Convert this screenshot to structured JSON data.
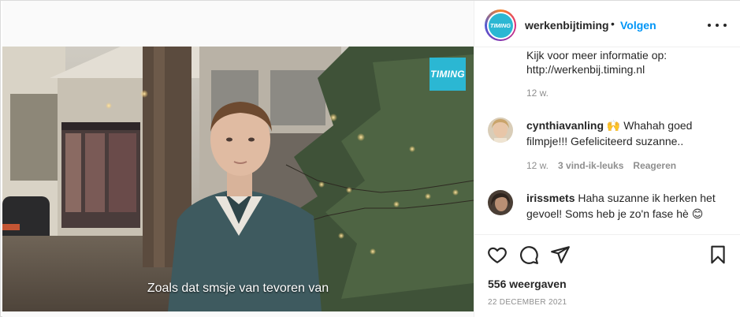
{
  "post": {
    "brand_badge": "TIMING",
    "subtitle": "Zoals dat smsje van tevoren van"
  },
  "header": {
    "avatar_text": "TIMING",
    "username": "werkenbijtiming",
    "separator": "•",
    "follow_label": "Volgen",
    "more_icon": "more-horizontal-icon"
  },
  "caption": {
    "line1": "Kijk voor meer informatie op:",
    "line2": "http://werkenbij.timing.nl",
    "time": "12 w."
  },
  "comments": [
    {
      "user": "cynthiavanling",
      "text": " 🙌 Whahah goed filmpje!!! Gefeliciteerd suzanne..",
      "time": "12 w.",
      "likes": "3 vind-ik-leuks",
      "reply": "Reageren"
    },
    {
      "user": "irissmets",
      "text": " Haha suzanne ik herken het gevoel! Soms heb je zo'n fase hè 😊"
    }
  ],
  "actions": {
    "like_icon": "heart-icon",
    "comment_icon": "comment-icon",
    "share_icon": "send-icon",
    "save_icon": "bookmark-icon"
  },
  "stats": {
    "views": "556 weergaven",
    "date": "22 DECEMBER 2021"
  },
  "colors": {
    "brand": "#2bb7d3",
    "follow": "#0095f6",
    "muted": "#8e8e8e"
  }
}
